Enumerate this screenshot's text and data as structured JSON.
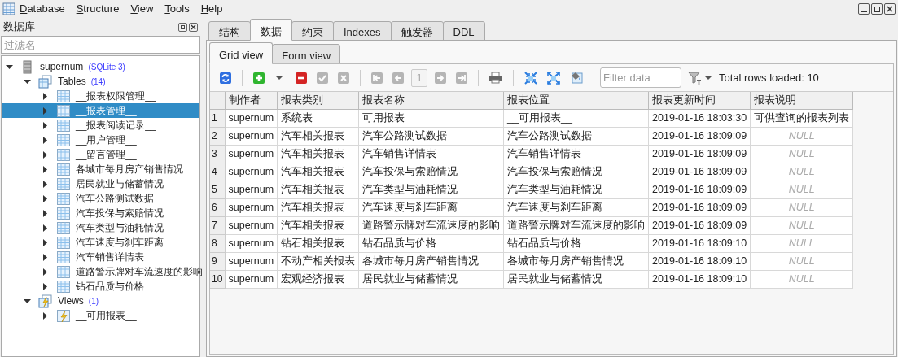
{
  "menu": [
    "Database",
    "Structure",
    "View",
    "Tools",
    "Help"
  ],
  "sidebar": {
    "title": "数据库",
    "filter": {
      "placeholder": "过滤名"
    },
    "tree": [
      {
        "kind": "database",
        "label": "supernum",
        "badge": "(SQLite 3)",
        "expanded": true,
        "selected": false,
        "children": [
          {
            "kind": "tables",
            "label": "Tables",
            "badge": "(14)",
            "expanded": true,
            "selected": false,
            "children": [
              {
                "kind": "table",
                "label": "__报表权限管理__",
                "expanded": false,
                "selected": false
              },
              {
                "kind": "table",
                "label": "__报表管理__",
                "expanded": false,
                "selected": true
              },
              {
                "kind": "table",
                "label": "__报表阅读记录__",
                "expanded": false,
                "selected": false
              },
              {
                "kind": "table",
                "label": "__用户管理__",
                "expanded": false,
                "selected": false
              },
              {
                "kind": "table",
                "label": "__留言管理__",
                "expanded": false,
                "selected": false
              },
              {
                "kind": "table",
                "label": "各城市每月房产销售情况",
                "expanded": false,
                "selected": false
              },
              {
                "kind": "table",
                "label": "居民就业与储蓄情况",
                "expanded": false,
                "selected": false
              },
              {
                "kind": "table",
                "label": "汽车公路测试数据",
                "expanded": false,
                "selected": false
              },
              {
                "kind": "table",
                "label": "汽车投保与索赔情况",
                "expanded": false,
                "selected": false
              },
              {
                "kind": "table",
                "label": "汽车类型与油耗情况",
                "expanded": false,
                "selected": false
              },
              {
                "kind": "table",
                "label": "汽车速度与刹车距离",
                "expanded": false,
                "selected": false
              },
              {
                "kind": "table",
                "label": "汽车销售详情表",
                "expanded": false,
                "selected": false
              },
              {
                "kind": "table",
                "label": "道路警示牌对车流速度的影响",
                "expanded": false,
                "selected": false
              },
              {
                "kind": "table",
                "label": "钻石品质与价格",
                "expanded": false,
                "selected": false
              }
            ]
          },
          {
            "kind": "views",
            "label": "Views",
            "badge": "(1)",
            "expanded": true,
            "selected": false,
            "children": [
              {
                "kind": "view",
                "label": "__可用报表__",
                "expanded": false,
                "selected": false
              }
            ]
          }
        ]
      }
    ]
  },
  "tabs": [
    {
      "label": "结构",
      "selected": false
    },
    {
      "label": "数据",
      "selected": true
    },
    {
      "label": "约束",
      "selected": false
    },
    {
      "label": "Indexes",
      "selected": false
    },
    {
      "label": "触发器",
      "selected": false
    },
    {
      "label": "DDL",
      "selected": false
    }
  ],
  "subtabs": [
    {
      "label": "Grid view",
      "selected": true
    },
    {
      "label": "Form view",
      "selected": false
    }
  ],
  "toolbar": {
    "buttons": [
      {
        "kind": "refresh",
        "disabled": false
      },
      {
        "kind": "sep"
      },
      {
        "kind": "add",
        "disabled": false
      },
      {
        "kind": "dropdown",
        "disabled": false
      },
      {
        "kind": "delete",
        "disabled": false
      },
      {
        "kind": "commit",
        "disabled": true
      },
      {
        "kind": "rollback",
        "disabled": true
      },
      {
        "kind": "sep"
      },
      {
        "kind": "first",
        "disabled": true
      },
      {
        "kind": "prev",
        "disabled": true
      },
      {
        "kind": "page",
        "disabled": true
      },
      {
        "kind": "next",
        "disabled": true
      },
      {
        "kind": "last",
        "disabled": true
      },
      {
        "kind": "sep"
      },
      {
        "kind": "print",
        "disabled": false
      },
      {
        "kind": "sep"
      },
      {
        "kind": "shrink",
        "disabled": false
      },
      {
        "kind": "expand",
        "disabled": false
      },
      {
        "kind": "paint",
        "disabled": false
      },
      {
        "kind": "sep"
      }
    ],
    "page": "1",
    "filter": {
      "placeholder": "Filter data"
    },
    "total": "Total rows loaded: 10"
  },
  "table": {
    "columns": [
      "制作者",
      "报表类别",
      "报表名称",
      "报表位置",
      "报表更新时间",
      "报表说明"
    ],
    "rows": [
      {
        "number": "1",
        "cells": [
          "supernum",
          "系统表",
          "可用报表",
          "__可用报表__",
          "2019-01-16 18:03:30",
          "可供查询的报表列表"
        ]
      },
      {
        "number": "2",
        "cells": [
          "supernum",
          "汽车相关报表",
          "汽车公路测试数据",
          "汽车公路测试数据",
          "2019-01-16 18:09:09",
          {
            "kind": "null",
            "text": "NULL"
          }
        ]
      },
      {
        "number": "3",
        "cells": [
          "supernum",
          "汽车相关报表",
          "汽车销售详情表",
          "汽车销售详情表",
          "2019-01-16 18:09:09",
          {
            "kind": "null",
            "text": "NULL"
          }
        ]
      },
      {
        "number": "4",
        "cells": [
          "supernum",
          "汽车相关报表",
          "汽车投保与索赔情况",
          "汽车投保与索赔情况",
          "2019-01-16 18:09:09",
          {
            "kind": "null",
            "text": "NULL"
          }
        ]
      },
      {
        "number": "5",
        "cells": [
          "supernum",
          "汽车相关报表",
          "汽车类型与油耗情况",
          "汽车类型与油耗情况",
          "2019-01-16 18:09:09",
          {
            "kind": "null",
            "text": "NULL"
          }
        ]
      },
      {
        "number": "6",
        "cells": [
          "supernum",
          "汽车相关报表",
          "汽车速度与刹车距离",
          "汽车速度与刹车距离",
          "2019-01-16 18:09:09",
          {
            "kind": "null",
            "text": "NULL"
          }
        ]
      },
      {
        "number": "7",
        "cells": [
          "supernum",
          "汽车相关报表",
          "道路警示牌对车流速度的影响",
          "道路警示牌对车流速度的影响",
          "2019-01-16 18:09:09",
          {
            "kind": "null",
            "text": "NULL"
          }
        ]
      },
      {
        "number": "8",
        "cells": [
          "supernum",
          "钻石相关报表",
          "钻石品质与价格",
          "钻石品质与价格",
          "2019-01-16 18:09:10",
          {
            "kind": "null",
            "text": "NULL"
          }
        ]
      },
      {
        "number": "9",
        "cells": [
          "supernum",
          "不动产相关报表",
          "各城市每月房产销售情况",
          "各城市每月房产销售情况",
          "2019-01-16 18:09:10",
          {
            "kind": "null",
            "text": "NULL"
          }
        ]
      },
      {
        "number": "10",
        "cells": [
          "supernum",
          "宏观经济报表",
          "居民就业与储蓄情况",
          "居民就业与储蓄情况",
          "2019-01-16 18:09:10",
          {
            "kind": "null",
            "text": "NULL"
          }
        ]
      }
    ]
  }
}
